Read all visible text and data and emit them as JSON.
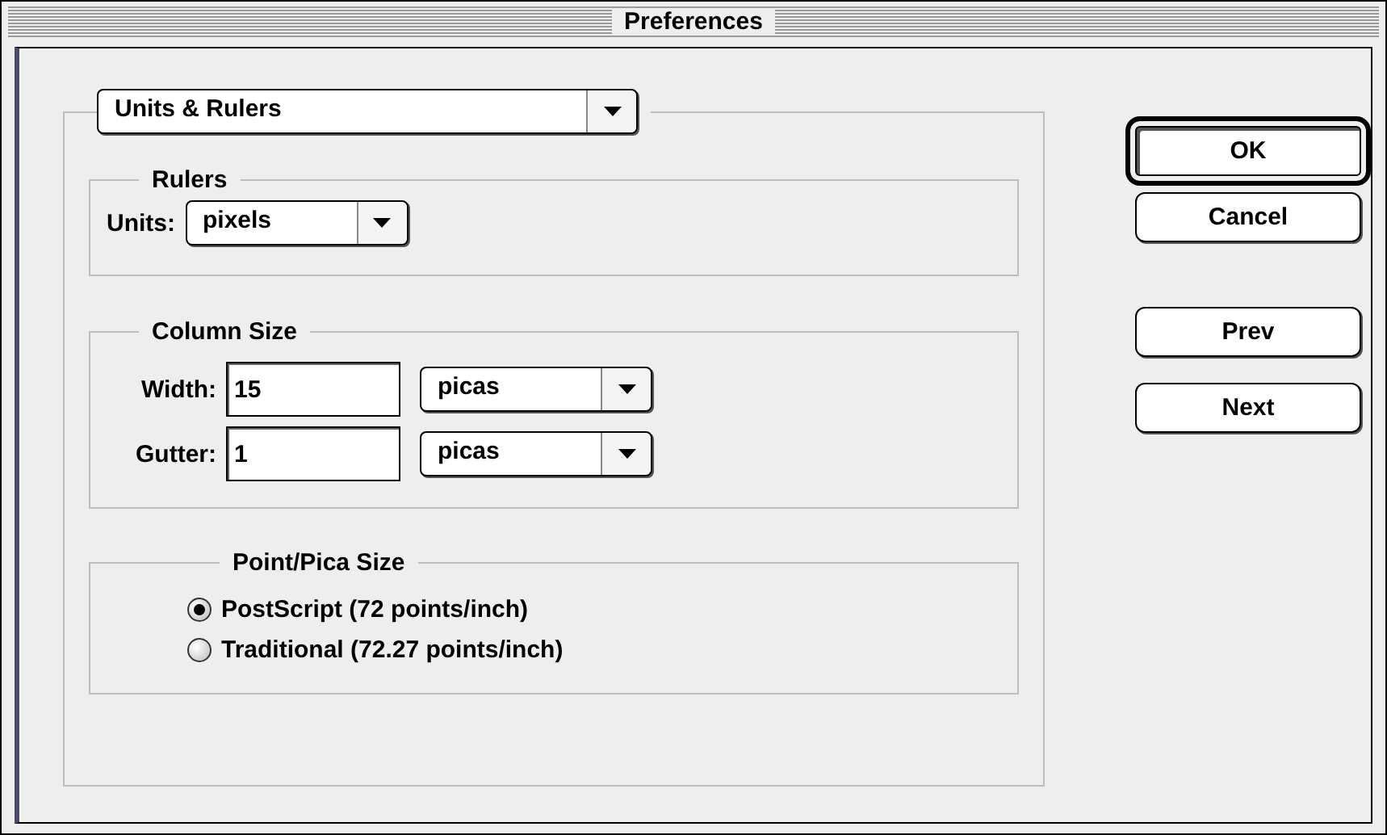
{
  "window": {
    "title": "Preferences"
  },
  "category": {
    "value": "Units & Rulers"
  },
  "rulers": {
    "title": "Rulers",
    "label": "Units:",
    "value": "pixels"
  },
  "column_size": {
    "title": "Column Size",
    "rows": [
      {
        "label": "Width:",
        "value": "15",
        "unit": "picas"
      },
      {
        "label": "Gutter:",
        "value": "1",
        "unit": "picas"
      }
    ]
  },
  "point_pica_size": {
    "title": "Point/Pica Size",
    "options": [
      {
        "label": "PostScript (72 points/inch)",
        "selected": true
      },
      {
        "label": "Traditional (72.27 points/inch)",
        "selected": false
      }
    ]
  },
  "buttons": [
    {
      "label": "OK",
      "default": true
    },
    {
      "label": "Cancel",
      "default": false
    },
    {
      "label": "Prev",
      "default": false
    },
    {
      "label": "Next",
      "default": false
    }
  ]
}
